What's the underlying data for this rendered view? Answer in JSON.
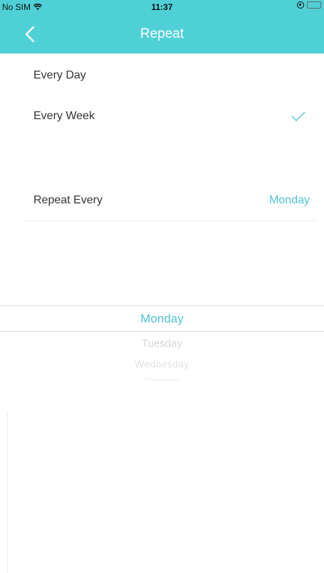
{
  "status_bar": {
    "carrier": "No SIM",
    "time": "11:37"
  },
  "nav": {
    "title": "Repeat"
  },
  "options": [
    {
      "label": "Every Day",
      "selected": false
    },
    {
      "label": "Every Week",
      "selected": true
    }
  ],
  "repeat_every": {
    "label": "Repeat Every",
    "value": "Monday"
  },
  "picker": {
    "selected": "Monday",
    "items": [
      "Tuesday",
      "Wednesday",
      "Thursday"
    ]
  },
  "colors": {
    "accent": "#4fd0d6",
    "value_text": "#4fc3d0"
  },
  "icons": [
    "wifi-icon",
    "back-chevron-icon",
    "checkmark-icon",
    "lock-rotation-icon",
    "battery-icon"
  ]
}
